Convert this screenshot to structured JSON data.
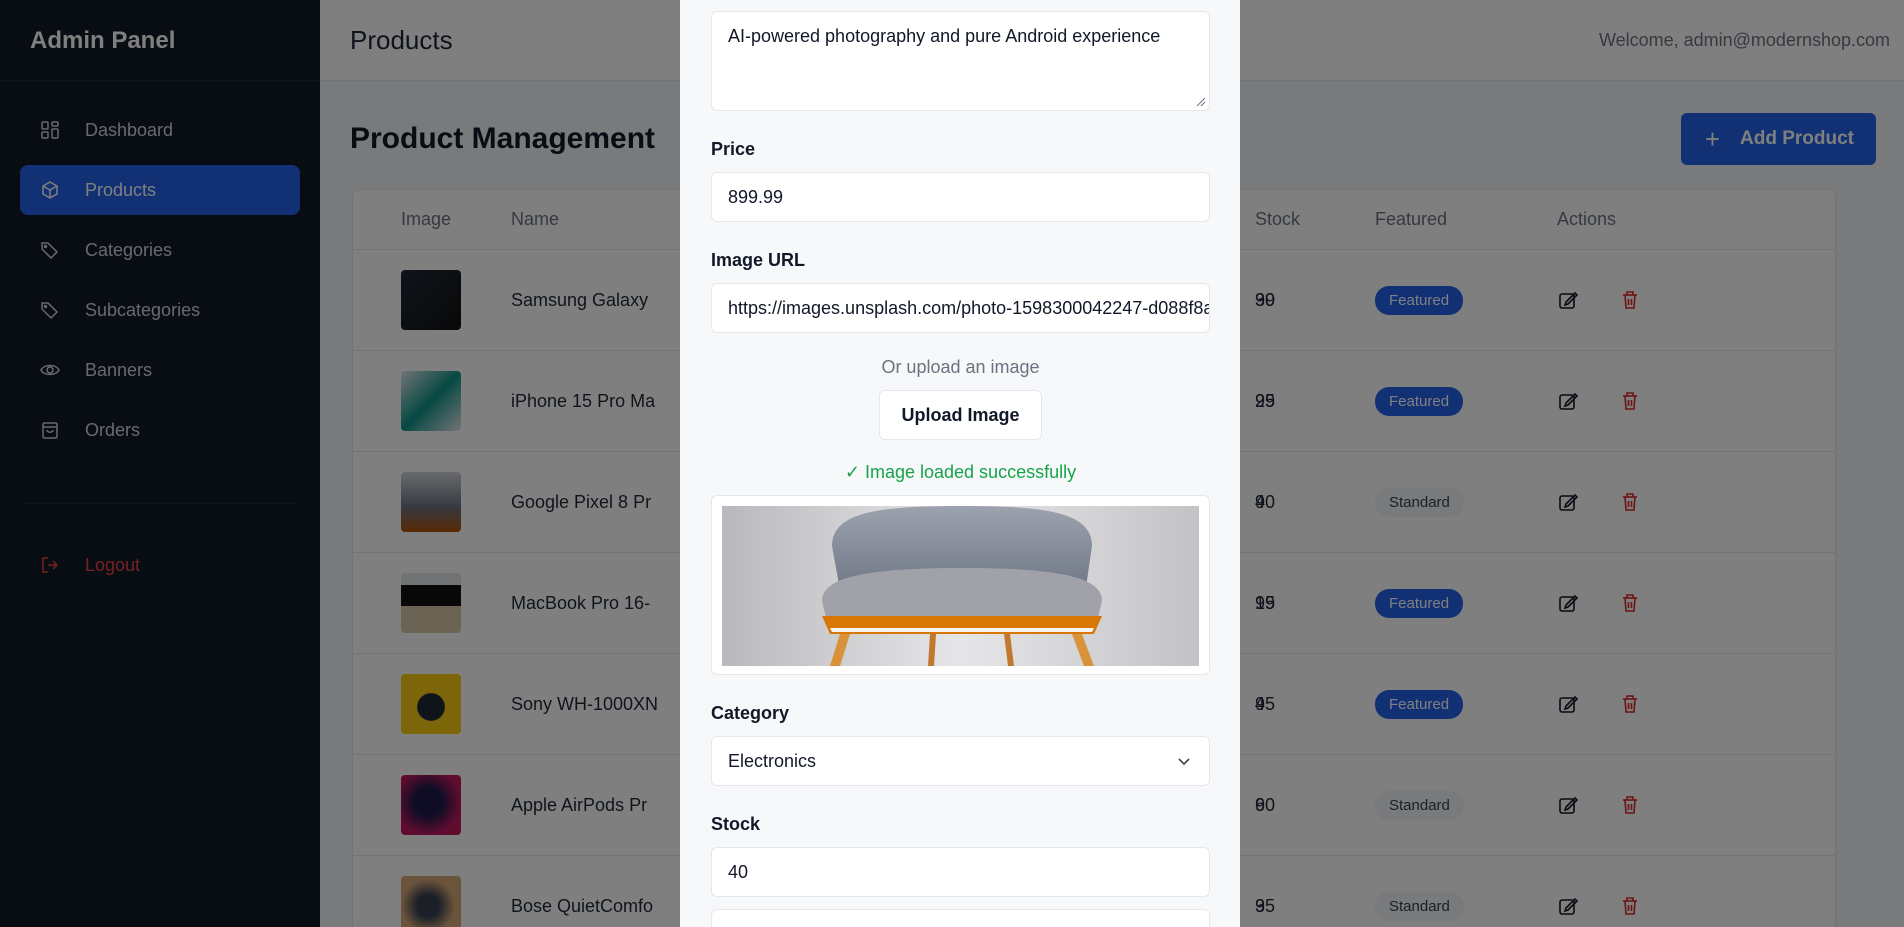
{
  "sidebar": {
    "brand": "Admin Panel",
    "items": [
      {
        "label": "Dashboard",
        "icon": "grid-icon",
        "active": false
      },
      {
        "label": "Products",
        "icon": "box-icon",
        "active": true
      },
      {
        "label": "Categories",
        "icon": "tag-icon",
        "active": false
      },
      {
        "label": "Subcategories",
        "icon": "tag-icon",
        "active": false
      },
      {
        "label": "Banners",
        "icon": "eye-icon",
        "active": false
      },
      {
        "label": "Orders",
        "icon": "shopping-bag-icon",
        "active": false
      }
    ],
    "logout": "Logout"
  },
  "header": {
    "title": "Products",
    "welcome": "Welcome, admin@modernshop.com"
  },
  "main": {
    "heading": "Product Management",
    "add_button": "Add Product",
    "columns": [
      "Image",
      "Name",
      "Stock",
      "Featured",
      "Actions"
    ],
    "rows": [
      {
        "name": "Samsung Galaxy",
        "price_tail": "99",
        "stock": "30",
        "featured": "Featured"
      },
      {
        "name": "iPhone 15 Pro Ma",
        "price_tail": "99",
        "stock": "25",
        "featured": "Featured"
      },
      {
        "name": "Google Pixel 8 Pr",
        "price_tail": "9",
        "stock": "40",
        "featured": "Standard"
      },
      {
        "name": "MacBook Pro 16-",
        "price_tail": "99",
        "stock": "15",
        "featured": "Featured"
      },
      {
        "name": "Sony WH-1000XN",
        "price_tail": "9",
        "stock": "45",
        "featured": "Featured"
      },
      {
        "name": "Apple AirPods Pr",
        "price_tail": "9",
        "stock": "60",
        "featured": "Standard"
      },
      {
        "name": "Bose QuietComfo",
        "price_tail": "9",
        "stock": "35",
        "featured": "Standard"
      }
    ]
  },
  "modal": {
    "description": "AI-powered photography and pure Android experience",
    "price_label": "Price",
    "price_value": "899.99",
    "image_url_label": "Image URL",
    "image_url_value": "https://images.unsplash.com/photo-1598300042247-d088f8a",
    "or_upload": "Or upload an image",
    "upload_button": "Upload Image",
    "loaded_message": "✓ Image loaded successfully",
    "category_label": "Category",
    "category_value": "Electronics",
    "stock_label": "Stock",
    "stock_value": "40"
  },
  "colors": {
    "sidebar_bg": "#111827",
    "accent": "#2563eb",
    "success": "#16a34a",
    "danger": "#dc2626"
  }
}
